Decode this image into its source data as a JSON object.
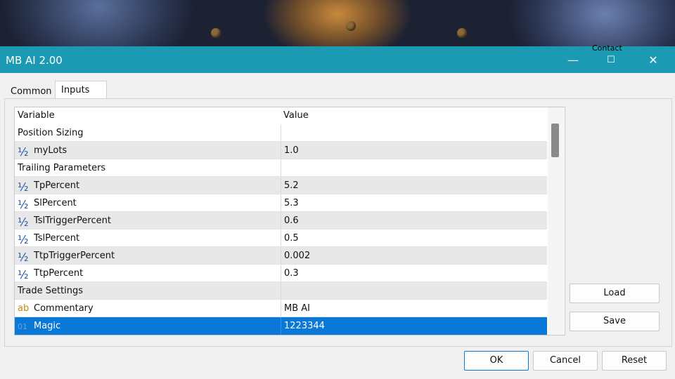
{
  "dialog": {
    "title": "MB AI 2.00",
    "contact_label": "Contact",
    "controls": {
      "minimize": "—",
      "maximize": "☐",
      "close": "✕"
    }
  },
  "tabs": [
    {
      "label": "Common",
      "active": false
    },
    {
      "label": "Inputs",
      "active": true
    }
  ],
  "grid": {
    "columns": [
      "Variable",
      "Value"
    ],
    "rows": [
      {
        "type": "group",
        "variable": "Position Sizing",
        "value": ""
      },
      {
        "type": "double",
        "icon": "½",
        "variable": "myLots",
        "value": "1.0"
      },
      {
        "type": "group",
        "variable": "Trailing Parameters",
        "value": ""
      },
      {
        "type": "double",
        "icon": "½",
        "variable": "TpPercent",
        "value": "5.2"
      },
      {
        "type": "double",
        "icon": "½",
        "variable": "SlPercent",
        "value": "5.3"
      },
      {
        "type": "double",
        "icon": "½",
        "variable": "TslTriggerPercent",
        "value": "0.6"
      },
      {
        "type": "double",
        "icon": "½",
        "variable": "TslPercent",
        "value": "0.5"
      },
      {
        "type": "double",
        "icon": "½",
        "variable": "TtpTriggerPercent",
        "value": "0.002"
      },
      {
        "type": "double",
        "icon": "½",
        "variable": "TtpPercent",
        "value": "0.3"
      },
      {
        "type": "group",
        "variable": "Trade Settings",
        "value": ""
      },
      {
        "type": "string",
        "icon": "ab",
        "variable": "Commentary",
        "value": "MB AI"
      },
      {
        "type": "int",
        "icon": "01",
        "variable": "Magic",
        "value": "1223344",
        "selected": true
      }
    ]
  },
  "side_buttons": {
    "load": "Load",
    "save": "Save"
  },
  "footer_buttons": {
    "ok": "OK",
    "cancel": "Cancel",
    "reset": "Reset"
  },
  "colors": {
    "titlebar": "#1c9ab3",
    "selection": "#0a78d7"
  }
}
